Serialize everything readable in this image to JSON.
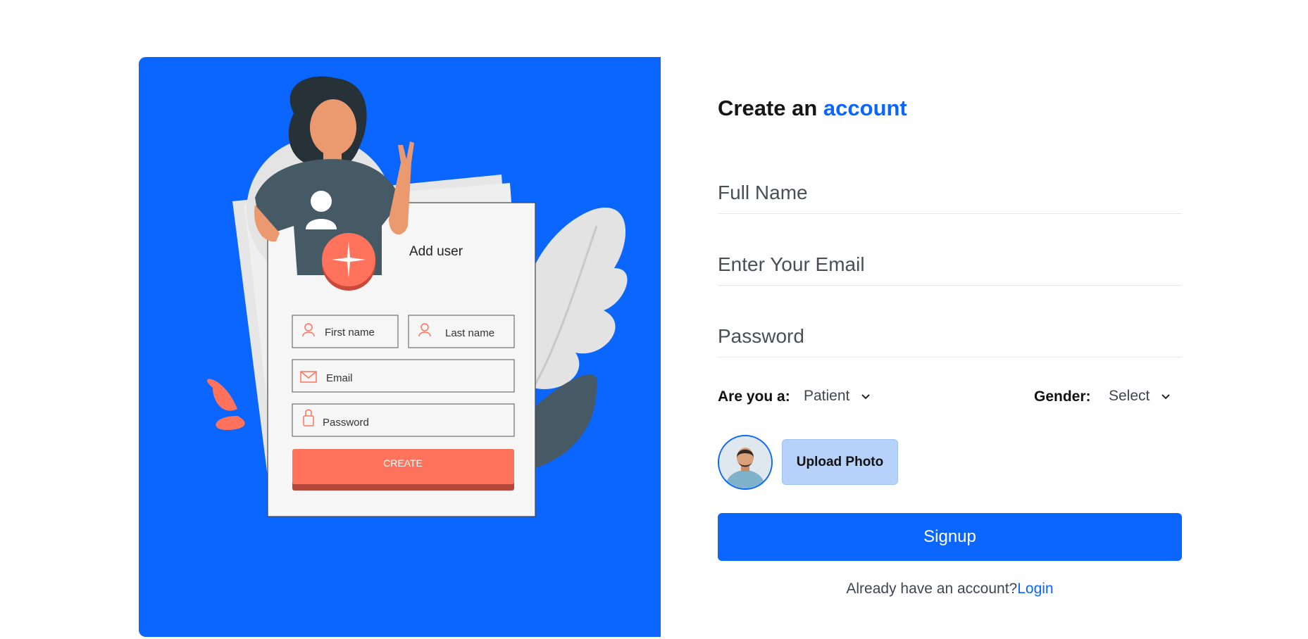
{
  "illustration": {
    "card_title": "Add user",
    "first_name": "First name",
    "last_name": "Last name",
    "email": "Email",
    "password": "Password",
    "create": "CREATE"
  },
  "form": {
    "title_prefix": "Create an ",
    "title_accent": "account",
    "full_name_placeholder": "Full Name",
    "email_placeholder": "Enter Your Email",
    "password_placeholder": "Password",
    "role_label": "Are you a:",
    "role_value": "Patient",
    "gender_label": "Gender:",
    "gender_value": "Select",
    "upload_label": "Upload Photo",
    "signup_label": "Signup",
    "login_prompt": "Already have an account?",
    "login_link": "Login"
  },
  "colors": {
    "primary": "#0a66ff",
    "upload_bg": "#b6d2fb",
    "coral": "#ff735c",
    "dark_slate": "#455a64"
  }
}
